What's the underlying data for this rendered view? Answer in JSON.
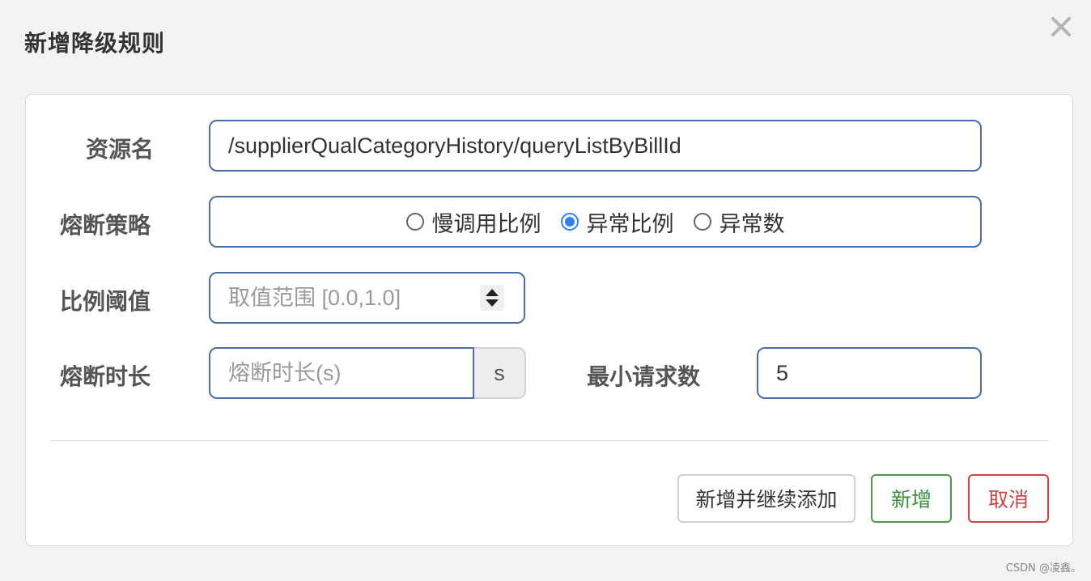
{
  "dialog": {
    "title": "新增降级规则"
  },
  "form": {
    "resource_label": "资源名",
    "resource_value": "/supplierQualCategoryHistory/queryListByBillId",
    "strategy_label": "熔断策略",
    "strategy_options": [
      {
        "label": "慢调用比例",
        "checked": false
      },
      {
        "label": "异常比例",
        "checked": true
      },
      {
        "label": "异常数",
        "checked": false
      }
    ],
    "ratio_label": "比例阈值",
    "ratio_placeholder": "取值范围 [0.0,1.0]",
    "duration_label": "熔断时长",
    "duration_placeholder": "熔断时长(s)",
    "duration_unit": "s",
    "min_requests_label": "最小请求数",
    "min_requests_value": "5"
  },
  "buttons": {
    "add_continue": "新增并继续添加",
    "add": "新增",
    "cancel": "取消"
  },
  "watermark": "CSDN @凌鑫。",
  "colors": {
    "input_border": "#4a6fa5",
    "radio_checked": "#2f7ff5",
    "add_green": "#3a8f3a",
    "cancel_red": "#c9474a"
  }
}
